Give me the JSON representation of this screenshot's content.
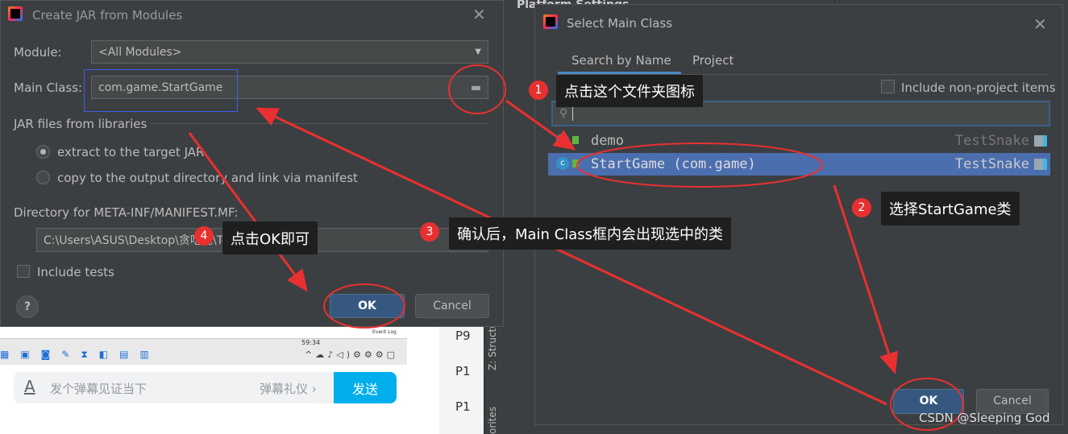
{
  "create_jar": {
    "title": "Create JAR from Modules",
    "module_label": "Module:",
    "module_value": "<All Modules>",
    "main_class_label": "Main Class:",
    "main_class_value": "com.game.StartGame",
    "jar_files_label": "JAR files from libraries",
    "option_extract": "extract to the target JAR",
    "option_copy": "copy to the output directory and link via manifest",
    "selected_option": "extract",
    "manifest_label": "Directory for META-INF/MANIFEST.MF:",
    "manifest_value": "C:\\Users\\ASUS\\Desktop\\贪吃蛇\\TestSnake\\src",
    "include_tests": "Include tests",
    "help": "?",
    "ok": "OK",
    "cancel": "Cancel"
  },
  "background_ide": {
    "platform_settings": "Platform Settings",
    "list_items": [
      "P9",
      "P1",
      "P1"
    ],
    "structure_tab": "Z: Structure",
    "favorites_tab": "orites"
  },
  "taskbar": {
    "time": "59:34",
    "event_log": "Event Log"
  },
  "danmaku": {
    "placeholder": "发个弹幕见证当下",
    "etiquette": "弹幕礼仪 ›",
    "send": "发送"
  },
  "select_main": {
    "title": "Select Main Class",
    "tabs": [
      "Search by Name",
      "Project"
    ],
    "active_tab": 0,
    "include_non_project": "Include non-project items",
    "search_value": "",
    "items": [
      {
        "name": "demo",
        "module": "TestSnake",
        "selected": false
      },
      {
        "name": "StartGame (com.game)",
        "module": "TestSnake",
        "selected": true
      }
    ],
    "ok": "OK",
    "cancel": "Cancel"
  },
  "annotations": [
    {
      "num": "1",
      "text": "点击这个文件夹图标"
    },
    {
      "num": "2",
      "text": "选择StartGame类"
    },
    {
      "num": "3",
      "text": "确认后，Main Class框内会出现选中的类"
    },
    {
      "num": "4",
      "text": "点击OK即可"
    }
  ],
  "watermark": "CSDN @Sleeping God",
  "colors": {
    "accent": "#365880",
    "selection": "#4b6eaf",
    "annotation": "#e83030",
    "send": "#00aeec"
  }
}
